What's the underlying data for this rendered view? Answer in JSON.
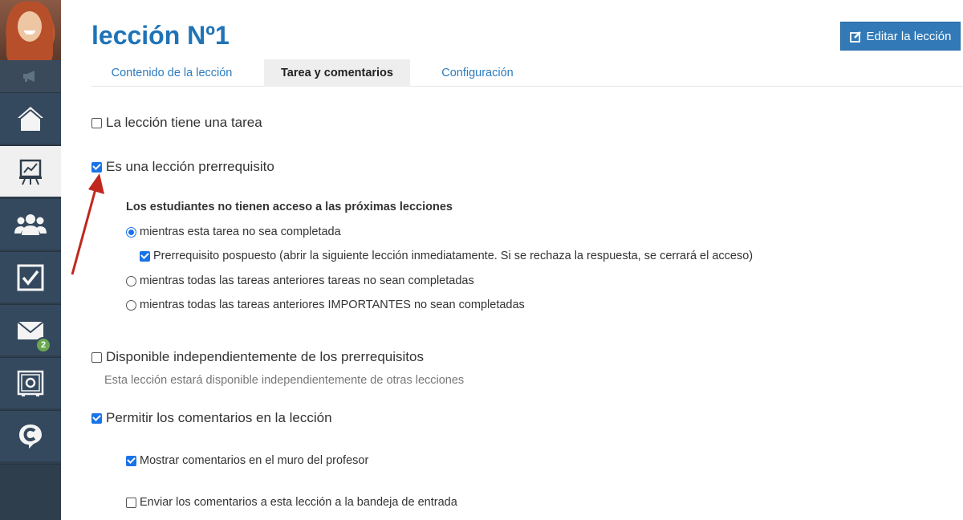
{
  "header": {
    "title": "lección Nº1",
    "edit_button_label": "Editar la lección"
  },
  "tabs": [
    {
      "label": "Contenido de la lección",
      "active": false
    },
    {
      "label": "Tarea y comentarios",
      "active": true
    },
    {
      "label": "Configuración",
      "active": false
    }
  ],
  "sidebar": {
    "items": [
      {
        "icon": "home-icon"
      },
      {
        "icon": "presentation-chart-icon",
        "active": true
      },
      {
        "icon": "users-icon"
      },
      {
        "icon": "checkbox-icon"
      },
      {
        "icon": "mail-icon",
        "badge": "2"
      },
      {
        "icon": "safe-icon"
      },
      {
        "icon": "chat-c-icon"
      }
    ]
  },
  "form": {
    "has_task": {
      "label": "La lección tiene una tarea",
      "checked": false
    },
    "prerequisite": {
      "label": "Es una lección prerrequisito",
      "checked": true
    },
    "access_heading": "Los estudiantes no tienen acceso a las próximas lecciones",
    "options": [
      {
        "label": "mientras esta tarea no sea completada",
        "checked": true
      },
      {
        "label": "mientras todas las tareas anteriores tareas no sean completadas",
        "checked": false
      },
      {
        "label": "mientras todas las tareas anteriores IMPORTANTES no sean completadas",
        "checked": false
      }
    ],
    "postponed": {
      "label": "Prerrequisito pospuesto (abrir la siguiente lección inmediatamente. Si se rechaza la respuesta, se cerrará el acceso)",
      "checked": true
    },
    "independent": {
      "label": "Disponible independientemente de los prerrequisitos",
      "checked": false,
      "hint": "Esta lección estará disponible independientemente de otras lecciones"
    },
    "comments": {
      "label": "Permitir los comentarios en la lección",
      "checked": true
    },
    "show_wall": {
      "label": "Mostrar comentarios en el muro del profesor",
      "checked": true
    },
    "send_inbox": {
      "label": "Enviar los comentarios a esta lección a la bandeja de entrada",
      "checked": false
    }
  },
  "colors": {
    "accent": "#1f73b7",
    "button": "#3279b7",
    "sidebar": "#34495e",
    "annotation_arrow": "#c0281e"
  }
}
